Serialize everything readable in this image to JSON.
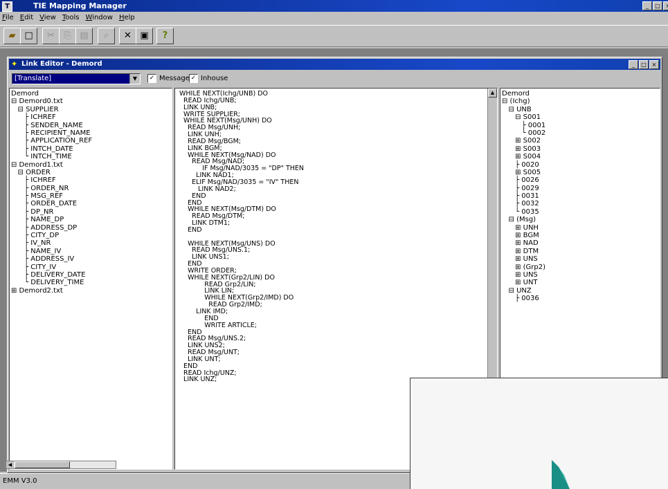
{
  "app": {
    "title": "TIE Mapping Manager",
    "icon": "app-icon"
  },
  "menu": [
    "File",
    "Edit",
    "View",
    "Tools",
    "Window",
    "Help"
  ],
  "toolbar": [
    {
      "name": "open-icon",
      "glyph": "▰",
      "enabled": true
    },
    {
      "name": "new-icon",
      "glyph": "□",
      "enabled": true
    },
    {
      "name": "cut-icon",
      "glyph": "✂",
      "enabled": false
    },
    {
      "name": "copy-icon",
      "glyph": "⎘",
      "enabled": false
    },
    {
      "name": "paste-icon",
      "glyph": "▤",
      "enabled": false
    },
    {
      "name": "find-icon",
      "glyph": "⌕",
      "enabled": false
    },
    {
      "name": "delete-icon",
      "glyph": "✕",
      "enabled": true
    },
    {
      "name": "properties-icon",
      "glyph": "▣",
      "enabled": true
    },
    {
      "name": "help-icon",
      "glyph": "?",
      "enabled": true
    }
  ],
  "child_window": {
    "title": "Link Editor - Demord",
    "mode_select": "[Translate]",
    "checkbox_message": {
      "label": "Message",
      "checked": true
    },
    "checkbox_inhouse": {
      "label": "Inhouse",
      "checked": true
    }
  },
  "left_tree": [
    "Demord",
    "⊟ Demord0.txt",
    "   ⊟ SUPPLIER",
    "      ├ ICHREF",
    "      ├ SENDER_NAME",
    "      ├ RECIPIENT_NAME",
    "      ├ APPLICATION_REF",
    "      ├ INTCH_DATE",
    "      └ INTCH_TIME",
    "⊟ Demord1.txt",
    "   ⊟ ORDER",
    "      ├ ICHREF",
    "      ├ ORDER_NR",
    "      ├ MSG_REF",
    "      ├ ORDER_DATE",
    "      ├ DP_NR",
    "      ├ NAME_DP",
    "      ├ ADDRESS_DP",
    "      ├ CITY_DP",
    "      ├ IV_NR",
    "      ├ NAME_IV",
    "      ├ ADDRESS_IV",
    "      ├ CITY_IV",
    "      ├ DELIVERY_DATE",
    "      └ DELIVERY_TIME",
    "⊞ Demord2.txt"
  ],
  "code": [
    "WHILE NEXT(Ichg/UNB) DO",
    "  READ Ichg/UNB;",
    "  LINK UNB;",
    "  WRITE SUPPLIER;",
    "  WHILE NEXT(Msg/UNH) DO",
    "    READ Msg/UNH;",
    "    LINK UNH;",
    "    READ Msg/BGM;",
    "    LINK BGM;",
    "    WHILE NEXT(Msg/NAD) DO",
    "      READ Msg/NAD;",
    "           IF Msg/NAD/3035 = \"DP\" THEN",
    "        LINK NAD1;",
    "      ELIF Msg/NAD/3035 = \"IV\" THEN",
    "         LINK NAD2;",
    "      END",
    "    END",
    "    WHILE NEXT(Msg/DTM) DO",
    "      READ Msg/DTM;",
    "      LINK DTM1;",
    "    END",
    "",
    "    WHILE NEXT(Msg/UNS) DO",
    "      READ Msg/UNS.1;",
    "      LINK UNS1;",
    "    END",
    "    WRITE ORDER;",
    "    WHILE NEXT(Grp2/LIN) DO",
    "            READ Grp2/LIN;",
    "            LINK LIN;",
    "            WHILE NEXT(Grp2/IMD) DO",
    "              READ Grp2/IMD;",
    "        LINK IMD;",
    "            END",
    "            WRITE ARTICLE;",
    "    END",
    "    READ Msg/UNS.2;",
    "    LINK UNS2;",
    "    READ Msg/UNT;",
    "    LINK UNT;",
    "  END",
    "  READ Ichg/UNZ;",
    "  LINK UNZ;"
  ],
  "right_tree": [
    "Demord",
    "⊟ (Ichg)",
    "   ⊟ UNB",
    "      ⊟ S001",
    "         ├ 0001",
    "         └ 0002",
    "      ⊞ S002",
    "      ⊞ S003",
    "      ⊞ S004",
    "      ├ 0020",
    "      ⊞ S005",
    "      ├ 0026",
    "      ├ 0029",
    "      ├ 0031",
    "      ├ 0032",
    "      └ 0035",
    "   ⊟ (Msg)",
    "      ⊞ UNH",
    "      ⊞ BGM",
    "      ⊞ NAD",
    "      ⊞ DTM",
    "      ⊞ UNS",
    "      ⊞ (Grp2)",
    "      ⊞ UNS",
    "      ⊞ UNT",
    "   ⊟ UNZ",
    "      ├ 0036"
  ],
  "status": {
    "text": "EMM V3.0"
  },
  "colors": {
    "title_bar": "#0a2a8a",
    "desktop": "#808080",
    "face": "#c0c0c0",
    "overlay_accent": "#2a9a8a"
  }
}
